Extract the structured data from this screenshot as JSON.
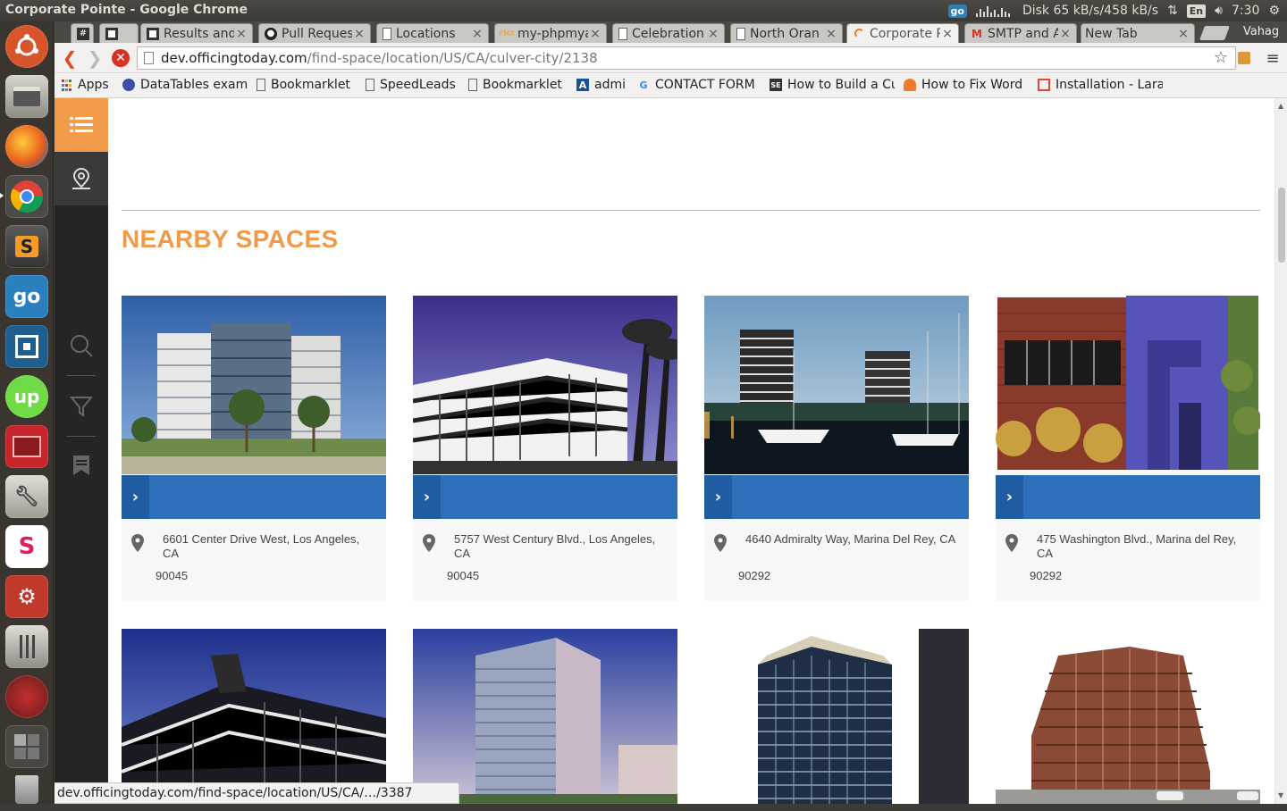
{
  "os": {
    "window_title": "Corporate Pointe - Google Chrome",
    "tray": {
      "badge": "go",
      "disk": "Disk 65 kB/s/458 kB/s",
      "lang": "En",
      "time": "7:30"
    },
    "launcher": [
      {
        "name": "ubuntu-dash",
        "color": "#d8542a"
      },
      {
        "name": "files",
        "color": "#7a7772"
      },
      {
        "name": "firefox",
        "color": "#e86b22"
      },
      {
        "name": "chrome",
        "color": "#3a7bd5"
      },
      {
        "name": "sublime-text",
        "color": "#4a4a4a"
      },
      {
        "name": "goldendict",
        "color": "#2a7fbf"
      },
      {
        "name": "workspace-switcher",
        "color": "#1f5f8f"
      },
      {
        "name": "upwork",
        "color": "#6fda44"
      },
      {
        "name": "filezilla",
        "color": "#c8242b"
      },
      {
        "name": "system-tool",
        "color": "#666460"
      },
      {
        "name": "slack",
        "color": "#ffffff"
      },
      {
        "name": "settings",
        "color": "#c0392b"
      },
      {
        "name": "sound-mixer",
        "color": "#6a6863"
      },
      {
        "name": "webcam",
        "color": "#a32a2a"
      },
      {
        "name": "workspaces",
        "color": "#555"
      },
      {
        "name": "trash",
        "color": "#888"
      }
    ]
  },
  "browser": {
    "tabs": [
      {
        "label": "#",
        "icon": "#"
      },
      {
        "label": "",
        "icon": "trello"
      },
      {
        "label": "Results and",
        "icon": "trello"
      },
      {
        "label": "Pull Reques",
        "icon": "github"
      },
      {
        "label": "Locations",
        "icon": "page"
      },
      {
        "label": "my-phpmya",
        "icon": "pma"
      },
      {
        "label": "Celebration",
        "icon": "page"
      },
      {
        "label": "North Oran",
        "icon": "page"
      },
      {
        "label": "Corporate P",
        "icon": "loading"
      },
      {
        "label": "SMTP and A",
        "icon": "gmail"
      },
      {
        "label": "New Tab",
        "icon": ""
      }
    ],
    "user": "Vahag",
    "url_host": "dev.officingtoday.com",
    "url_path": "/find-space/location/US/CA/culver-city/2138",
    "bookmarks": [
      {
        "label": "Apps",
        "icon": "apps"
      },
      {
        "label": "DataTables exam",
        "icon": "globe"
      },
      {
        "label": "Bookmarklet",
        "icon": "page"
      },
      {
        "label": "SpeedLeads",
        "icon": "page"
      },
      {
        "label": "Bookmarklet",
        "icon": "page"
      },
      {
        "label": "admi",
        "icon": "A"
      },
      {
        "label": "CONTACT FORM",
        "icon": "G"
      },
      {
        "label": "How to Build a Cu",
        "icon": "SE"
      },
      {
        "label": "How to Fix Word",
        "icon": "helmet"
      },
      {
        "label": "Installation - Lara",
        "icon": "laravel"
      }
    ],
    "status_url": "dev.officingtoday.com/find-space/location/US/CA/…/3387"
  },
  "page": {
    "section_title": "NEARBY SPACES",
    "accent": "#ef9a4a",
    "bar_color": "#2e6fba",
    "spaces": [
      {
        "address": "6601 Center Drive West, Los Angeles, CA",
        "zip": "90045",
        "arrow": "›"
      },
      {
        "address": "5757 West Century Blvd., Los Angeles, CA",
        "zip": "90045",
        "arrow": "›"
      },
      {
        "address": "4640 Admiralty Way, Marina Del Rey, CA",
        "zip": "90292",
        "arrow": "›"
      },
      {
        "address": "475 Washington Blvd., Marina del Rey, CA",
        "zip": "90292",
        "arrow": "›"
      }
    ]
  }
}
